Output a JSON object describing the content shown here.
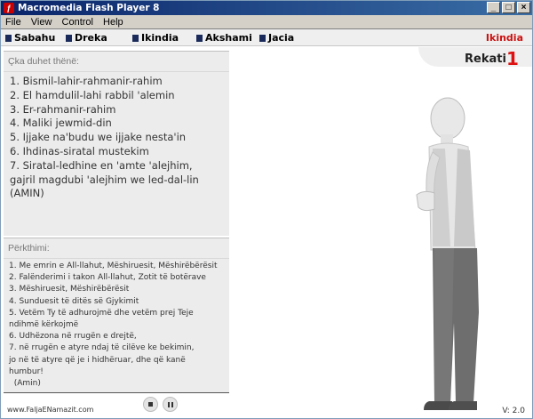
{
  "window": {
    "title": "Macromedia Flash Player 8",
    "app_icon": "flash-icon"
  },
  "menu": [
    "File",
    "View",
    "Control",
    "Help"
  ],
  "nav": {
    "items": [
      "Sabahu",
      "Dreka",
      "Ikindia",
      "Akshami",
      "Jacia"
    ],
    "current": "Ikindia"
  },
  "rakat": {
    "label": "Rekati",
    "number": "1"
  },
  "say_panel": {
    "heading": "Çka duhet thënë:",
    "lines": [
      "1. Bismil-lahir-rahmanir-rahim",
      "2. El hamdulil-lahi rabbil 'alemin",
      "3. Er-rahmanir-rahim",
      "4. Maliki jewmid-din",
      "5. Ijjake na'budu we ijjake nesta'in",
      "6. Ihdinas-siratal mustekim",
      "7. Siratal-ledhine en 'amte 'alejhim,",
      "gajril magdubi 'alejhim we led-dal-lin",
      "(AMIN)"
    ]
  },
  "translation_panel": {
    "heading": "Përkthimi:",
    "lines": [
      "1. Me emrin e All-llahut, Mëshiruesit, Mëshirëbërësit",
      "2. Falënderimi i takon All-llahut, Zotit të botërave",
      "3. Mëshiruesit, Mëshirëbërësit",
      "4. Sunduesit të ditës së Gjykimit",
      "5. Vetëm Ty të adhurojmë dhe vetëm prej Teje",
      "ndihmë kërkojmë",
      "6. Udhëzona në rrugën e drejtë,",
      "7. në rrugën e atyre ndaj të cilëve ke bekimin,",
      "jo në të atyre që je i hidhëruar, dhe që kanë",
      "humbur!",
      "  (Amin)"
    ]
  },
  "footer": {
    "site": "www.FaljaENamazit.com",
    "version": "V: 2.0"
  },
  "colors": {
    "accent": "#cc1111",
    "titlebar": "#0a246a",
    "panel": "#ececec"
  }
}
